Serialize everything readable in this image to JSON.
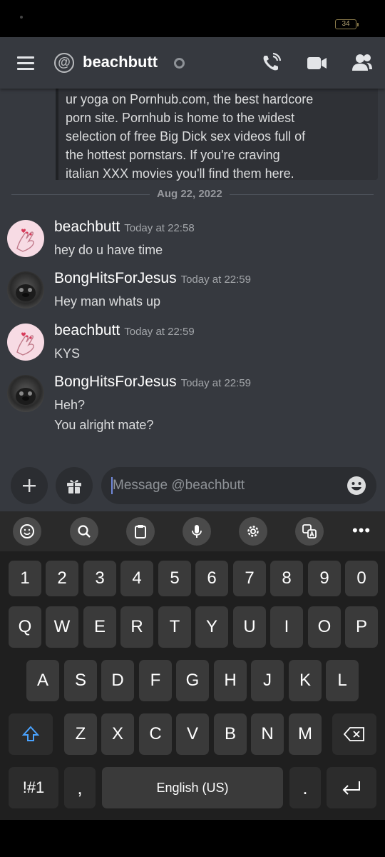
{
  "status_bar": {
    "battery": "34"
  },
  "header": {
    "title": "beachbutt",
    "at_symbol": "@"
  },
  "embed": {
    "lines": [
      "ur yoga on Pornhub.com, the best hardcore",
      "porn site. Pornhub is home to the widest",
      "selection of free Big Dick sex videos full of",
      "the hottest pornstars. If you're craving",
      "italian XXX movies you'll find them here."
    ]
  },
  "date_divider": "Aug 22, 2022",
  "messages": [
    {
      "author": "beachbutt",
      "time": "Today at 22:58",
      "lines": [
        "hey do u have time"
      ]
    },
    {
      "author": "BongHitsForJesus",
      "time": "Today at 22:59",
      "lines": [
        "Hey man whats up"
      ]
    },
    {
      "author": "beachbutt",
      "time": "Today at 22:59",
      "lines": [
        "KYS"
      ]
    },
    {
      "author": "BongHitsForJesus",
      "time": "Today at 22:59",
      "lines": [
        "Heh?",
        "You alright mate?"
      ]
    }
  ],
  "composer": {
    "placeholder": "Message @beachbutt"
  },
  "keyboard": {
    "toolbar_more": "•••",
    "number_row": [
      "1",
      "2",
      "3",
      "4",
      "5",
      "6",
      "7",
      "8",
      "9",
      "0"
    ],
    "row_q": [
      "Q",
      "W",
      "E",
      "R",
      "T",
      "Y",
      "U",
      "I",
      "O",
      "P"
    ],
    "row_a": [
      "A",
      "S",
      "D",
      "F",
      "G",
      "H",
      "J",
      "K",
      "L"
    ],
    "row_z": [
      "Z",
      "X",
      "C",
      "V",
      "B",
      "N",
      "M"
    ],
    "symbols_key": "!#1",
    "comma_key": ",",
    "space_label": "English (US)",
    "period_key": "."
  },
  "colors": {
    "background": "#36393f",
    "accent": "#7289da",
    "keyboard": "#1f1f1f"
  }
}
